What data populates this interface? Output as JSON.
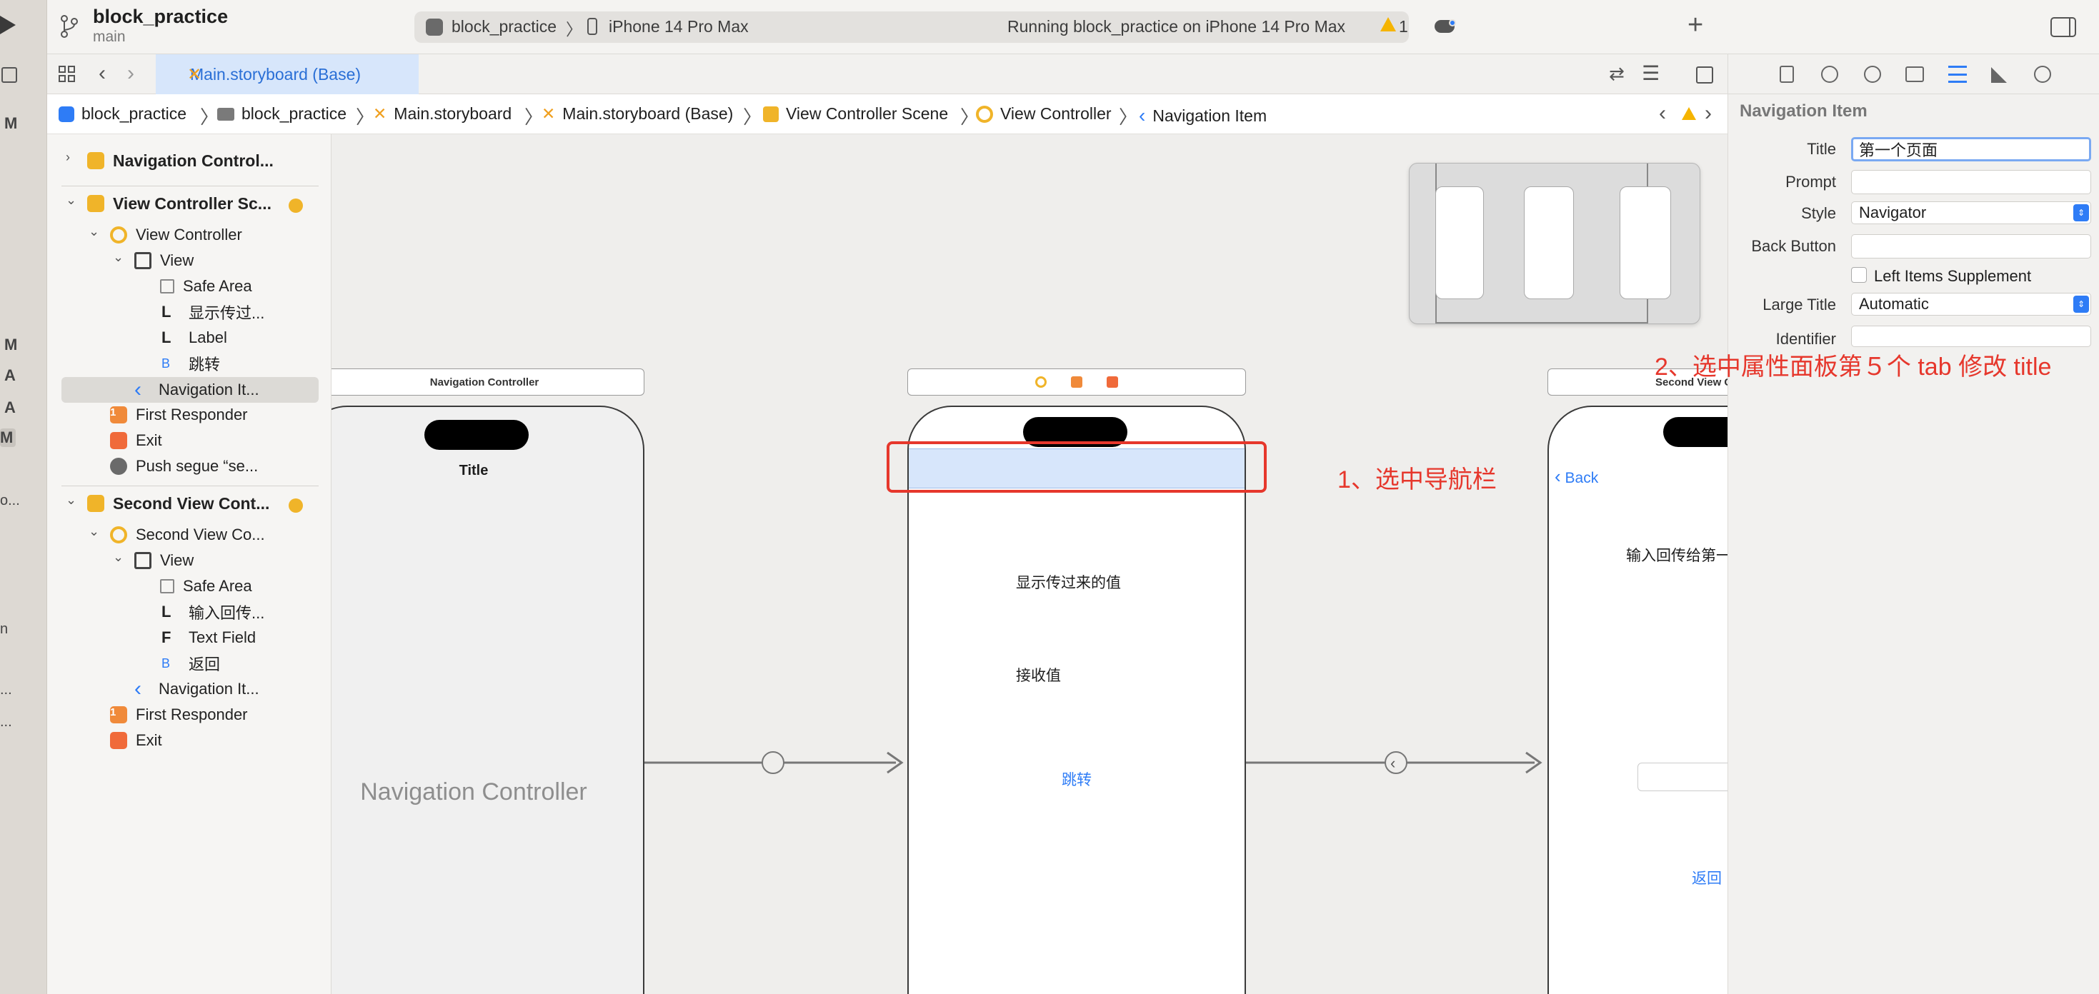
{
  "leftstrip": {
    "letters": [
      "M",
      "M",
      "A",
      "A",
      "M",
      "o...",
      "n",
      "...",
      "..."
    ]
  },
  "toolbar": {
    "project": "block_practice",
    "branch": "main",
    "scheme": "block_practice",
    "device": "iPhone 14 Pro Max",
    "status": "Running block_practice on iPhone 14 Pro Max",
    "warnings": "1",
    "add": "+"
  },
  "tabbar": {
    "tab_label": "Main.storyboard (Base)"
  },
  "breadcrumb": {
    "items": [
      "block_practice",
      "block_practice",
      "Main.storyboard",
      "Main.storyboard (Base)",
      "View Controller Scene",
      "View Controller",
      "Navigation Item"
    ]
  },
  "outline": {
    "nav_scene": "Navigation Control...",
    "vc_scene": "View Controller Sc...",
    "vc": "View Controller",
    "view": "View",
    "safe_area": "Safe Area",
    "label1": "显示传过...",
    "label2": "Label",
    "button": "跳转",
    "nav_item": "Navigation It...",
    "first_responder": "First Responder",
    "exit": "Exit",
    "segue": "Push segue “se...",
    "second_scene": "Second View Cont...",
    "second_vc": "Second View Co...",
    "view2": "View",
    "safe_area2": "Safe Area",
    "label3": "输入回传...",
    "text_field": "Text Field",
    "back_btn": "返回",
    "nav_item2": "Navigation It...",
    "first_responder2": "First Responder",
    "exit2": "Exit",
    "letters": {
      "l": "L",
      "b": "B",
      "f": "F",
      "one": "1"
    }
  },
  "canvas": {
    "nav_scene_title": "Navigation Controller",
    "nav_title": "Title",
    "nav_placeholder": "Navigation Controller",
    "vc_label1": "显示传过来的值",
    "vc_label2": "接收值",
    "vc_button": "跳转",
    "second_scene_title": "Second View C",
    "back": "Back",
    "second_label": "输入回传给第一",
    "second_button": "返回",
    "annotation1": "1、选中导航栏",
    "annotation2": "2、选中属性面板第５个 tab 修改 title"
  },
  "inspector": {
    "section": "Navigation Item",
    "title_label": "Title",
    "title_value": "第一个页面",
    "prompt_label": "Prompt",
    "style_label": "Style",
    "style_value": "Navigator",
    "back_label": "Back Button",
    "left_items": "Left Items Supplement",
    "large_title_label": "Large Title",
    "large_title_value": "Automatic",
    "identifier_label": "Identifier"
  },
  "colors": {
    "accent": "#2e7cf6",
    "annotation": "#e6372c",
    "scene_icon": "#f0b429",
    "warning": "#f5b400"
  }
}
